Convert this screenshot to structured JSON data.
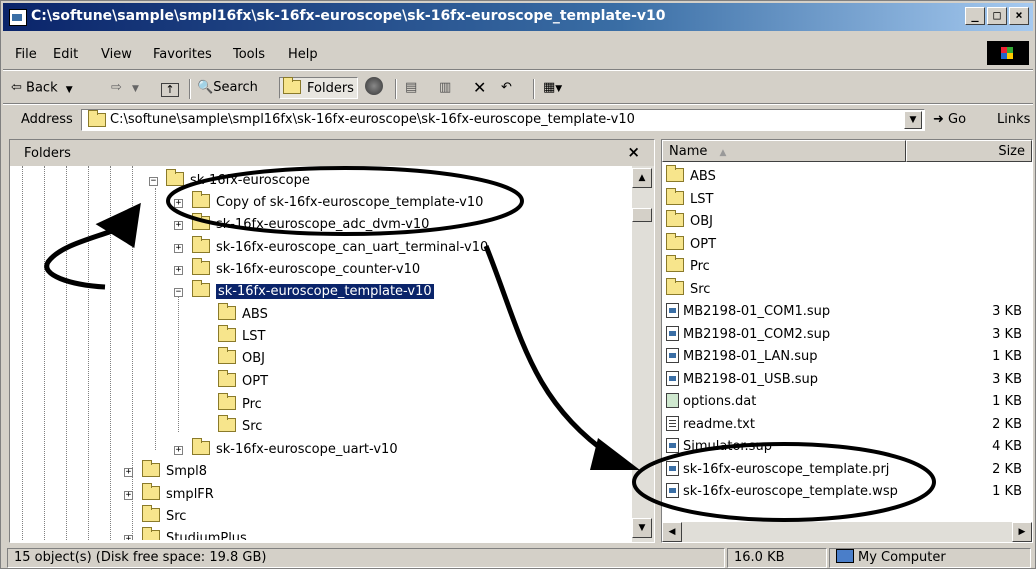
{
  "window": {
    "title": "C:\\softune\\sample\\smpl16fx\\sk-16fx-euroscope\\sk-16fx-euroscope_template-v10"
  },
  "menu": [
    "File",
    "Edit",
    "View",
    "Favorites",
    "Tools",
    "Help"
  ],
  "toolbar": {
    "back": "Back",
    "search": "Search",
    "folders": "Folders"
  },
  "address": {
    "label": "Address",
    "value": "C:\\softune\\sample\\smpl16fx\\sk-16fx-euroscope\\sk-16fx-euroscope_template-v10",
    "go": "Go",
    "links": "Links"
  },
  "folders_pane": {
    "title": "Folders",
    "close": "×",
    "tree": {
      "parent": "sk-16fx-euroscope",
      "children": [
        "Copy of sk-16fx-euroscope_template-v10",
        "sk-16fx-euroscope_adc_dvm-v10",
        "sk-16fx-euroscope_can_uart_terminal-v10",
        "sk-16fx-euroscope_counter-v10",
        "sk-16fx-euroscope_template-v10"
      ],
      "selected_children": [
        "ABS",
        "LST",
        "OBJ",
        "OPT",
        "Prc",
        "Src"
      ],
      "after": [
        "sk-16fx-euroscope_uart-v10"
      ],
      "siblings": [
        "Smpl8",
        "smplFR",
        "Src",
        "StudiumPlus"
      ]
    }
  },
  "list_pane": {
    "col_name": "Name",
    "col_size": "Size",
    "items": [
      {
        "name": "ABS",
        "size": "",
        "icon": "folder"
      },
      {
        "name": "LST",
        "size": "",
        "icon": "folder"
      },
      {
        "name": "OBJ",
        "size": "",
        "icon": "folder"
      },
      {
        "name": "OPT",
        "size": "",
        "icon": "folder"
      },
      {
        "name": "Prc",
        "size": "",
        "icon": "folder"
      },
      {
        "name": "Src",
        "size": "",
        "icon": "folder"
      },
      {
        "name": "MB2198-01_COM1.sup",
        "size": "3 KB",
        "icon": "sup"
      },
      {
        "name": "MB2198-01_COM2.sup",
        "size": "3 KB",
        "icon": "sup"
      },
      {
        "name": "MB2198-01_LAN.sup",
        "size": "1 KB",
        "icon": "sup"
      },
      {
        "name": "MB2198-01_USB.sup",
        "size": "3 KB",
        "icon": "sup"
      },
      {
        "name": "options.dat",
        "size": "1 KB",
        "icon": "dat"
      },
      {
        "name": "readme.txt",
        "size": "2 KB",
        "icon": "txt"
      },
      {
        "name": "Simulator.sup",
        "size": "4 KB",
        "icon": "sup"
      },
      {
        "name": "sk-16fx-euroscope_template.prj",
        "size": "2 KB",
        "icon": "sup"
      },
      {
        "name": "sk-16fx-euroscope_template.wsp",
        "size": "1 KB",
        "icon": "sup"
      }
    ]
  },
  "status": {
    "objects": "15 object(s) (Disk free space: 19.8 GB)",
    "size": "16.0 KB",
    "zone": "My Computer"
  }
}
